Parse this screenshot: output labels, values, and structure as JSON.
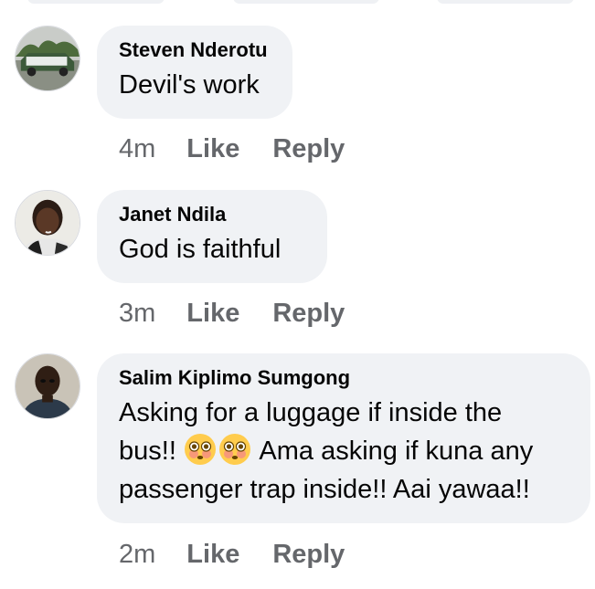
{
  "comments": [
    {
      "author": "Steven Nderotu",
      "lines": [
        "Devil's work"
      ],
      "time": "4m",
      "like_label": "Like",
      "reply_label": "Reply"
    },
    {
      "author": "Janet Ndila",
      "lines": [
        "God is faithful"
      ],
      "time": "3m",
      "like_label": "Like",
      "reply_label": "Reply"
    },
    {
      "author": "Salim Kiplimo Sumgong",
      "line1": "Asking for a luggage if inside the",
      "line2_pre": "bus!! ",
      "line2_emoji": "flushed-face-emoji",
      "line2_post": " Ama asking if kuna any",
      "line3": "passenger trap inside!! Aai yawaa!!",
      "time": "2m",
      "like_label": "Like",
      "reply_label": "Reply"
    }
  ],
  "colors": {
    "bubble": "#f0f2f5",
    "name_text": "#050505",
    "meta_text": "#65676b"
  }
}
